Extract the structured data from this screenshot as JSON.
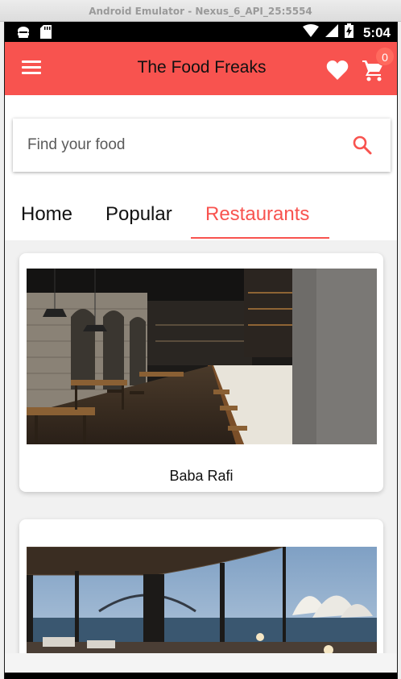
{
  "window": {
    "title": "Android Emulator - Nexus_6_API_25:5554"
  },
  "status_bar": {
    "time": "5:04"
  },
  "app_bar": {
    "title": "The Food Freaks",
    "cart_count": "0",
    "accent": "#f8534f"
  },
  "search": {
    "placeholder": "Find your food"
  },
  "tabs": [
    {
      "label": "Home",
      "active": false
    },
    {
      "label": "Popular",
      "active": false
    },
    {
      "label": "Restaurants",
      "active": true
    }
  ],
  "restaurants": [
    {
      "name": "Baba Rafi",
      "image": "restaurant-interior-photo"
    },
    {
      "name": "",
      "image": "harbour-view-dining-photo"
    }
  ]
}
